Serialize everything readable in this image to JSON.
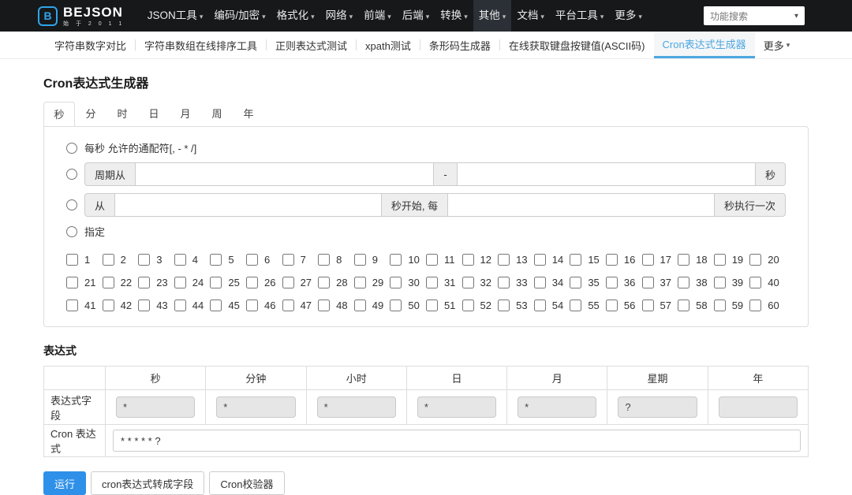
{
  "topnav": {
    "logo": {
      "icon_letter": "B",
      "name": "BEJSON",
      "subtitle": "始 于 2 0 1 1"
    },
    "items": [
      {
        "label": "JSON工具",
        "active": false
      },
      {
        "label": "编码/加密",
        "active": false
      },
      {
        "label": "格式化",
        "active": false
      },
      {
        "label": "网络",
        "active": false
      },
      {
        "label": "前端",
        "active": false
      },
      {
        "label": "后端",
        "active": false
      },
      {
        "label": "转换",
        "active": false
      },
      {
        "label": "其他",
        "active": true
      },
      {
        "label": "文档",
        "active": false
      },
      {
        "label": "平台工具",
        "active": false
      },
      {
        "label": "更多",
        "active": false
      }
    ],
    "search_placeholder": "功能搜索"
  },
  "subnav": {
    "items": [
      {
        "label": "字符串数字对比",
        "active": false,
        "dropdown": false
      },
      {
        "label": "字符串数组在线排序工具",
        "active": false,
        "dropdown": false
      },
      {
        "label": "正则表达式测试",
        "active": false,
        "dropdown": false
      },
      {
        "label": "xpath测试",
        "active": false,
        "dropdown": false
      },
      {
        "label": "条形码生成器",
        "active": false,
        "dropdown": false
      },
      {
        "label": "在线获取键盘按键值(ASCII码)",
        "active": false,
        "dropdown": false
      },
      {
        "label": "Cron表达式生成器",
        "active": true,
        "dropdown": false
      },
      {
        "label": "更多",
        "active": false,
        "dropdown": true
      }
    ]
  },
  "page": {
    "title": "Cron表达式生成器"
  },
  "tabs": {
    "items": [
      "秒",
      "分",
      "时",
      "日",
      "月",
      "周",
      "年"
    ],
    "active": "秒"
  },
  "panel": {
    "every_label": "每秒 允许的通配符[, - * /]",
    "cycle": {
      "prefix": "周期从",
      "separator": "-",
      "suffix": "秒",
      "from_value": "",
      "to_value": ""
    },
    "interval": {
      "prefix": "从",
      "mid": "秒开始, 每",
      "suffix": "秒执行一次",
      "start_value": "",
      "step_value": ""
    },
    "specify_label": "指定",
    "checkbox_numbers": [
      1,
      2,
      3,
      4,
      5,
      6,
      7,
      8,
      9,
      10,
      11,
      12,
      13,
      14,
      15,
      16,
      17,
      18,
      19,
      20,
      21,
      22,
      23,
      24,
      25,
      26,
      27,
      28,
      29,
      30,
      31,
      32,
      33,
      34,
      35,
      36,
      37,
      38,
      39,
      40,
      41,
      42,
      43,
      44,
      45,
      46,
      47,
      48,
      49,
      50,
      51,
      52,
      53,
      54,
      55,
      56,
      57,
      58,
      59,
      60
    ],
    "checked_numbers": []
  },
  "expression": {
    "section_label": "表达式",
    "headers": [
      "",
      "秒",
      "分钟",
      "小时",
      "日",
      "月",
      "星期",
      "年"
    ],
    "field_row_label": "表达式字段",
    "field_values": [
      "*",
      "*",
      "*",
      "*",
      "*",
      "?",
      ""
    ],
    "cron_row_label": "Cron 表达式",
    "cron_value": "* * * * * ?"
  },
  "actions": [
    {
      "label": "运行",
      "variant": "primary"
    },
    {
      "label": "cron表达式转成字段",
      "variant": "default"
    },
    {
      "label": "Cron校验器",
      "variant": "default"
    }
  ],
  "colors": {
    "topbar_bg": "#16181a",
    "logo_blue": "#2fa4ea",
    "subnav_active_blue": "#4ea7e0",
    "primary_button_blue": "#2e90e8"
  }
}
